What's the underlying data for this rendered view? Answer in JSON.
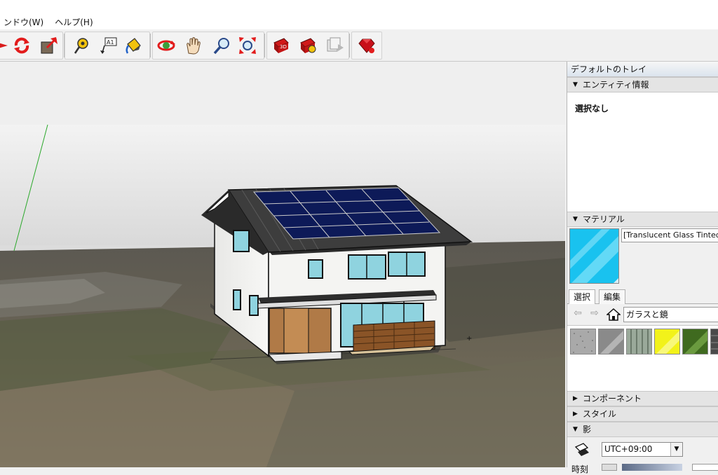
{
  "menu": {
    "items": [
      {
        "label": "ンドウ(W)"
      },
      {
        "label": "ヘルプ(H)"
      }
    ]
  },
  "toolbar": {
    "tools": [
      {
        "name": "orbit-left-icon"
      },
      {
        "name": "follow-me-icon"
      },
      {
        "name": "scale-icon"
      },
      {
        "name": "tape-measure-icon"
      },
      {
        "name": "dimension-text-icon"
      },
      {
        "name": "paint-bucket-icon"
      },
      {
        "name": "orbit-icon"
      },
      {
        "name": "pan-icon"
      },
      {
        "name": "zoom-icon"
      },
      {
        "name": "zoom-extents-icon"
      },
      {
        "name": "3d-warehouse-icon"
      },
      {
        "name": "extension-warehouse-icon"
      },
      {
        "name": "share-model-icon"
      },
      {
        "name": "ruby-console-icon"
      }
    ]
  },
  "tray": {
    "title": "デフォルトのトレイ",
    "entity_panel": {
      "title": "エンティティ情報",
      "selection": "選択なし"
    },
    "material_panel": {
      "title": "マテリアル",
      "material_name": "[Translucent Glass Tinted]",
      "tabs": [
        {
          "label": "選択",
          "active": true
        },
        {
          "label": "編集",
          "active": false
        }
      ],
      "collection": "ガラスと鏡",
      "swatches": [
        {
          "name": "gray-speckle-swatch",
          "color": "#a9a9a9"
        },
        {
          "name": "gray-diagonal-swatch",
          "color": "#8a8a8a"
        },
        {
          "name": "green-stripe-swatch",
          "color": "#9aa99a"
        },
        {
          "name": "yellow-swatch",
          "color": "#f2f21a"
        },
        {
          "name": "dark-green-swatch",
          "color": "#3f6a1f"
        },
        {
          "name": "dark-gray-swatch",
          "color": "#4a4a4a"
        }
      ]
    },
    "collapsed_panels": [
      {
        "title": "コンポーネント",
        "expanded": false
      },
      {
        "title": "スタイル",
        "expanded": false
      },
      {
        "title": "影",
        "expanded": true
      }
    ],
    "shadow_panel": {
      "timezone": "UTC+09:00",
      "time_label": "時刻"
    }
  },
  "colors": {
    "sky": "#e6e6e6",
    "ground": "#5e5a52",
    "roof": "#3c3c3c",
    "solar_panel": "#0d1a58",
    "wall": "#f2f2f0",
    "wood": "#b07a47",
    "window": "#8fd3df",
    "glass_swatch": "#19c2ef"
  }
}
